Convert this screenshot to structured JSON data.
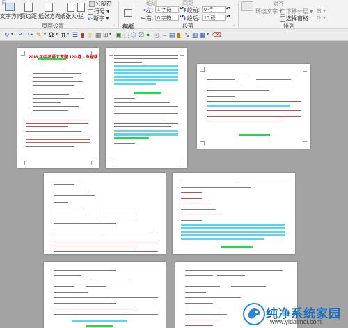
{
  "ribbon": {
    "row1": {
      "margins_partial": "白",
      "breaks_partial": "分隔符",
      "indent_label": "缩进",
      "spacing_label": "间距",
      "wrap_text_partial": "环绕文字",
      "align_partial": "对齐"
    },
    "buttons": {
      "text_direction": "文字方向",
      "margins": "页边距",
      "orientation": "纸张方向",
      "size": "纸张大小",
      "columns_partial": "栏",
      "line_numbers": "行号",
      "hyphenation": "断字",
      "draft": "稿纸\n设置",
      "send_backward": "下移一层",
      "selection_pane": "选择窗格"
    },
    "indent": {
      "left_label": "左:",
      "left_value": "1 字符",
      "right_label": "右:",
      "right_value": "0 字符"
    },
    "spacing": {
      "before_label": "段前:",
      "before_value": "0 行",
      "after_label": "段后:",
      "after_value": "10 磅"
    },
    "groups": {
      "page_setup": "页面设置",
      "draft": "稿纸",
      "paragraph": "段落",
      "arrange": "排列"
    }
  },
  "qat_icons": [
    "rotate-icon",
    "undo-icon",
    "redo-icon",
    "format-painter-icon",
    "pi-icon",
    "indent-icon",
    "font-color-icon",
    "box-icon",
    "table-icon",
    "grid-icon",
    "shape-icon",
    "hexagon-icon",
    "picture-icon",
    "checkbox-icon",
    "arrow-icon",
    "box2-icon",
    "cube-icon",
    "arrow2-icon",
    "box3-icon",
    "table2-icon",
    "eraser-icon"
  ],
  "doc": {
    "page1_title": "2018 年中考语文真题 120 卷 - 命题帮"
  },
  "watermark": {
    "name": "纯净系统家园",
    "url": "www.yidaimei.com"
  },
  "colors": {
    "highlight_cyan": "#5fd3ee",
    "highlight_green": "#27d64a",
    "title_red": "#c00000",
    "ribbon_bg": "#f3f3f3"
  }
}
